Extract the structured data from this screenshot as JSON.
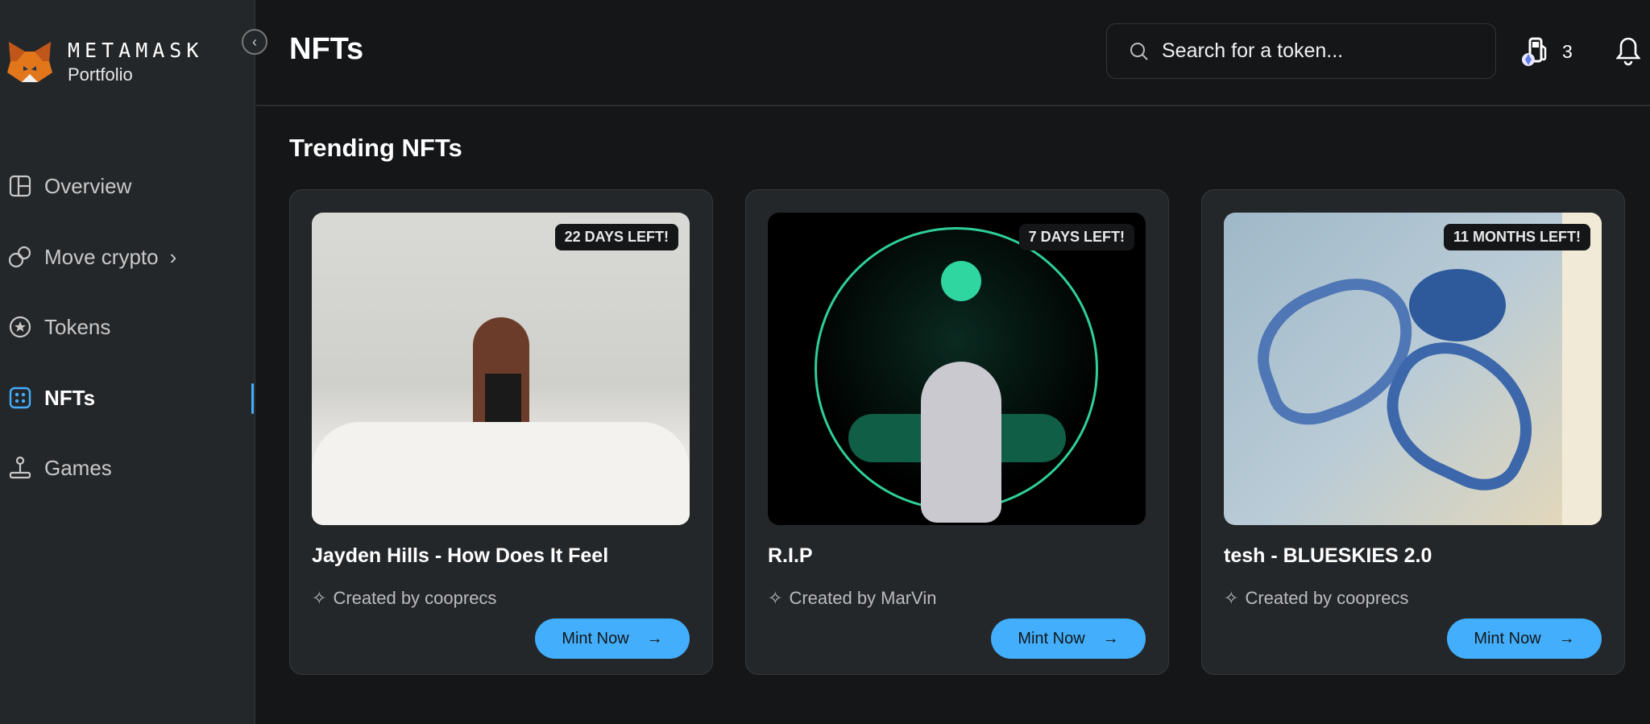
{
  "brand": {
    "name": "METAMASK",
    "sub": "Portfolio"
  },
  "sidebar": {
    "items": [
      {
        "label": "Overview",
        "icon": "layout-icon"
      },
      {
        "label": "Move crypto",
        "icon": "transfer-icon"
      },
      {
        "label": "Tokens",
        "icon": "token-icon"
      },
      {
        "label": "NFTs",
        "icon": "nft-icon",
        "active": true
      },
      {
        "label": "Games",
        "icon": "joystick-icon"
      }
    ]
  },
  "header": {
    "title": "NFTs",
    "search_placeholder": "Search for a token...",
    "gas_count": "3"
  },
  "section": {
    "title": "Trending NFTs"
  },
  "cards": [
    {
      "badge": "22 DAYS LEFT!",
      "title": "Jayden Hills - How Does It Feel",
      "creator": "Created by cooprecs",
      "button": "Mint Now"
    },
    {
      "badge": "7 DAYS LEFT!",
      "title": "R.I.P",
      "creator": "Created by MarVin",
      "button": "Mint Now"
    },
    {
      "badge": "11 MONTHS LEFT!",
      "title": "tesh - BLUESKIES 2.0",
      "creator": "Created by cooprecs",
      "button": "Mint Now"
    }
  ],
  "colors": {
    "accent": "#43aefc",
    "sidebar": "#24272a",
    "background": "#141618"
  }
}
